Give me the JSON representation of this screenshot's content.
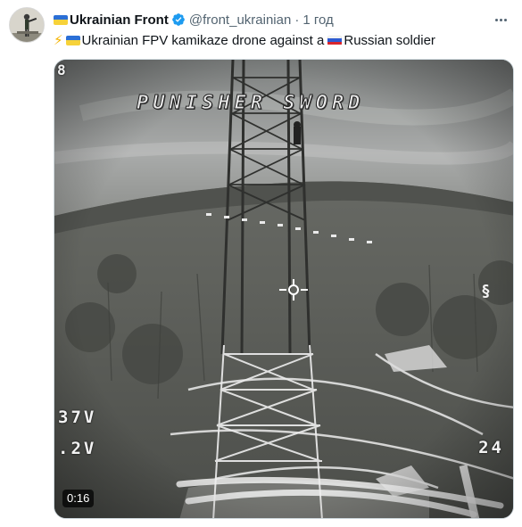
{
  "account": {
    "name": "Ukrainian Front",
    "handle": "@front_ukrainian",
    "separator": "·",
    "time": "1 год",
    "verified": true,
    "avatar_icon": "avatar-image"
  },
  "tweet": {
    "text_part1": "Ukrainian FPV kamikaze drone against a",
    "text_part2": "Russian soldier",
    "icons": [
      "lightning-icon",
      "ukraine-flag-icon",
      "russia-flag-icon"
    ]
  },
  "media": {
    "type": "video",
    "duration": "0:16",
    "osd": {
      "title": "PUNISHER SWORD",
      "voltage": "37V",
      "current": ".2V",
      "count": "24",
      "corner": "8"
    }
  },
  "colors": {
    "verified_blue": "#1d9bf0",
    "secondary_text": "#536471",
    "primary_text": "#0f1419"
  }
}
